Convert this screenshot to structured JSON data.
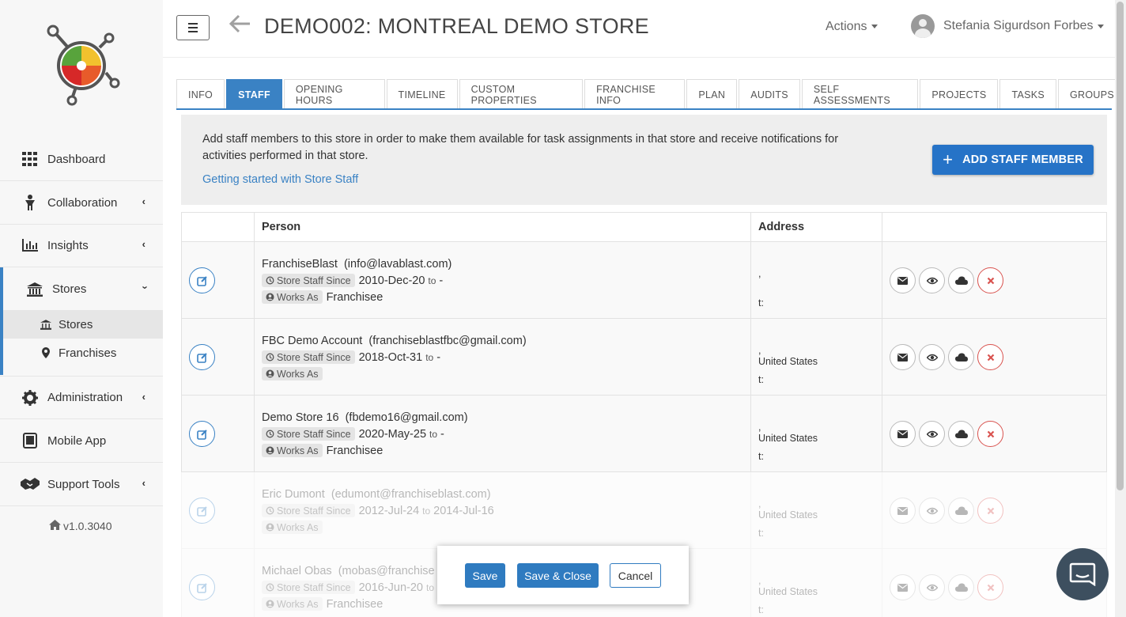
{
  "header": {
    "title": "DEMO002: MONTREAL DEMO STORE",
    "actions_label": "Actions",
    "user_name": "Stefania Sigurdson Forbes"
  },
  "sidebar": {
    "items": [
      {
        "label": "Dashboard"
      },
      {
        "label": "Collaboration"
      },
      {
        "label": "Insights"
      },
      {
        "label": "Stores"
      },
      {
        "label": "Administration"
      },
      {
        "label": "Mobile App"
      },
      {
        "label": "Support Tools"
      }
    ],
    "sub_items": [
      {
        "label": "Stores"
      },
      {
        "label": "Franchises"
      }
    ],
    "version": "v1.0.3040"
  },
  "tabs": [
    {
      "label": "INFO"
    },
    {
      "label": "STAFF"
    },
    {
      "label": "OPENING HOURS"
    },
    {
      "label": "TIMELINE"
    },
    {
      "label": "CUSTOM PROPERTIES"
    },
    {
      "label": "FRANCHISE INFO"
    },
    {
      "label": "PLAN"
    },
    {
      "label": "AUDITS"
    },
    {
      "label": "SELF ASSESSMENTS"
    },
    {
      "label": "PROJECTS"
    },
    {
      "label": "TASKS"
    },
    {
      "label": "GROUPS"
    }
  ],
  "info": {
    "text": "Add staff members to this store in order to make them available for task assignments in that store and receive notifications for activities performed in that store.",
    "link": "Getting started with Store Staff",
    "add_button": "ADD STAFF MEMBER"
  },
  "table": {
    "headers": {
      "person": "Person",
      "address": "Address"
    },
    "labels": {
      "since": "Store Staff Since",
      "works_as": "Works As",
      "to": "to"
    },
    "rows": [
      {
        "name": "FranchiseBlast",
        "email": "(info@lavablast.com)",
        "since": "2010-Dec-20",
        "until": "-",
        "role": "Franchisee",
        "addr1": ",",
        "addr2": "",
        "addr3": "t:"
      },
      {
        "name": "FBC Demo Account",
        "email": "(franchiseblastfbc@gmail.com)",
        "since": "2018-Oct-31",
        "until": "-",
        "role": "",
        "addr1": ",",
        "addr2": "United States",
        "addr3": "t:"
      },
      {
        "name": "Demo Store 16",
        "email": "(fbdemo16@gmail.com)",
        "since": "2020-May-25",
        "until": "-",
        "role": "Franchisee",
        "addr1": ",",
        "addr2": "United States",
        "addr3": "t:"
      },
      {
        "name": "Eric Dumont",
        "email": "(edumont@franchiseblast.com)",
        "since": "2012-Jul-24",
        "until": "2014-Jul-16",
        "role": "",
        "addr1": ",",
        "addr2": "United States",
        "addr3": "t:"
      },
      {
        "name": "Michael Obas",
        "email": "(mobas@franchise",
        "since": "2016-Jun-20",
        "until": "",
        "role": "Franchisee",
        "addr1": ",",
        "addr2": "United States",
        "addr3": "t:"
      }
    ]
  },
  "dialog": {
    "save": "Save",
    "save_close": "Save & Close",
    "cancel": "Cancel"
  },
  "colors": {
    "accent": "#3a82c4",
    "primary_button": "#2673c7",
    "delete": "#d9534f"
  }
}
